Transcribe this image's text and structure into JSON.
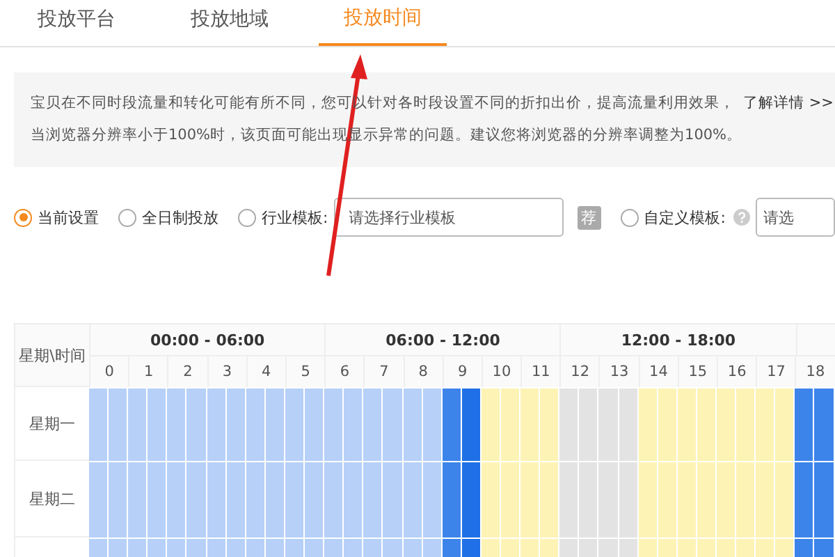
{
  "tabs": [
    {
      "label": "投放平台",
      "selected": false
    },
    {
      "label": "投放地域",
      "selected": false
    },
    {
      "label": "投放时间",
      "selected": true
    }
  ],
  "notice": {
    "text": "宝贝在不同时段流量和转化可能有所不同，您可以针对各时段设置不同的折扣出价，提高流量利用效果，",
    "link": "了解详情 >>",
    "warning": "当浏览器分辨率小于100%时，该页面可能出现显示异常的问题。建议您将浏览器的分辨率调整为100%。"
  },
  "options": [
    {
      "label": "当前设置",
      "selected": true
    },
    {
      "label": "全日制投放",
      "selected": false
    },
    {
      "label": "行业模板:",
      "selected": false,
      "placeholder": "请选择行业模板",
      "badge": "荐"
    },
    {
      "label": "自定义模板:",
      "selected": false,
      "help": true,
      "placeholder": "请选"
    }
  ],
  "schedule": {
    "corner": "星期\\时间",
    "groups": [
      "00:00 - 06:00",
      "06:00 - 12:00",
      "12:00 - 18:00"
    ],
    "hours": [
      "0",
      "1",
      "2",
      "3",
      "4",
      "5",
      "6",
      "7",
      "8",
      "9",
      "10",
      "11",
      "12",
      "13",
      "14",
      "15",
      "16",
      "17",
      "18"
    ],
    "rows": [
      {
        "day": "星期一",
        "slots": [
          {
            "kind": "light"
          },
          {
            "kind": "light"
          },
          {
            "kind": "light"
          },
          {
            "kind": "light"
          },
          {
            "kind": "light"
          },
          {
            "kind": "light"
          },
          {
            "kind": "light"
          },
          {
            "kind": "light"
          },
          {
            "kind": "light"
          },
          {
            "kind": "light"
          },
          {
            "kind": "light"
          },
          {
            "kind": "light"
          },
          {
            "kind": "light"
          },
          {
            "kind": "light"
          },
          {
            "kind": "light"
          },
          {
            "kind": "light"
          },
          {
            "kind": "light"
          },
          {
            "kind": "light"
          },
          {
            "kind": "medium"
          },
          {
            "kind": "dark"
          },
          {
            "kind": "yellow"
          },
          {
            "kind": "yellow"
          },
          {
            "kind": "yellow"
          },
          {
            "kind": "yellow"
          },
          {
            "kind": "grey"
          },
          {
            "kind": "grey"
          },
          {
            "kind": "grey"
          },
          {
            "kind": "grey"
          },
          {
            "kind": "yellow"
          },
          {
            "kind": "yellow"
          },
          {
            "kind": "yellow"
          },
          {
            "kind": "yellow"
          },
          {
            "kind": "yellow"
          },
          {
            "kind": "yellow"
          },
          {
            "kind": "yellow"
          },
          {
            "kind": "yellow"
          },
          {
            "kind": "medium"
          },
          {
            "kind": "medium"
          }
        ]
      },
      {
        "day": "星期二",
        "slots": [
          {
            "kind": "light"
          },
          {
            "kind": "light"
          },
          {
            "kind": "light"
          },
          {
            "kind": "light"
          },
          {
            "kind": "light"
          },
          {
            "kind": "light"
          },
          {
            "kind": "light"
          },
          {
            "kind": "light"
          },
          {
            "kind": "light"
          },
          {
            "kind": "light"
          },
          {
            "kind": "light"
          },
          {
            "kind": "light"
          },
          {
            "kind": "light"
          },
          {
            "kind": "light"
          },
          {
            "kind": "light"
          },
          {
            "kind": "light"
          },
          {
            "kind": "light"
          },
          {
            "kind": "light"
          },
          {
            "kind": "medium"
          },
          {
            "kind": "dark"
          },
          {
            "kind": "yellow"
          },
          {
            "kind": "yellow"
          },
          {
            "kind": "yellow"
          },
          {
            "kind": "yellow"
          },
          {
            "kind": "grey"
          },
          {
            "kind": "grey"
          },
          {
            "kind": "grey"
          },
          {
            "kind": "grey"
          },
          {
            "kind": "yellow"
          },
          {
            "kind": "yellow"
          },
          {
            "kind": "yellow"
          },
          {
            "kind": "yellow"
          },
          {
            "kind": "yellow"
          },
          {
            "kind": "yellow"
          },
          {
            "kind": "yellow"
          },
          {
            "kind": "yellow"
          },
          {
            "kind": "medium"
          },
          {
            "kind": "medium"
          }
        ]
      },
      {
        "slots": [
          {
            "kind": "light"
          },
          {
            "kind": "light"
          },
          {
            "kind": "light"
          },
          {
            "kind": "light"
          },
          {
            "kind": "light"
          },
          {
            "kind": "light"
          },
          {
            "kind": "light"
          },
          {
            "kind": "light"
          },
          {
            "kind": "light"
          },
          {
            "kind": "light"
          },
          {
            "kind": "light"
          },
          {
            "kind": "light"
          },
          {
            "kind": "light"
          },
          {
            "kind": "light"
          },
          {
            "kind": "light"
          },
          {
            "kind": "light"
          },
          {
            "kind": "light"
          },
          {
            "kind": "light"
          },
          {
            "kind": "medium"
          },
          {
            "kind": "dark"
          },
          {
            "kind": "yellow"
          },
          {
            "kind": "yellow"
          },
          {
            "kind": "yellow"
          },
          {
            "kind": "yellow"
          },
          {
            "kind": "grey"
          },
          {
            "kind": "grey"
          },
          {
            "kind": "grey"
          },
          {
            "kind": "grey"
          },
          {
            "kind": "yellow"
          },
          {
            "kind": "yellow"
          },
          {
            "kind": "yellow"
          },
          {
            "kind": "yellow"
          },
          {
            "kind": "yellow"
          },
          {
            "kind": "yellow"
          },
          {
            "kind": "yellow"
          },
          {
            "kind": "yellow"
          },
          {
            "kind": "medium"
          },
          {
            "kind": "medium"
          }
        ]
      }
    ]
  }
}
